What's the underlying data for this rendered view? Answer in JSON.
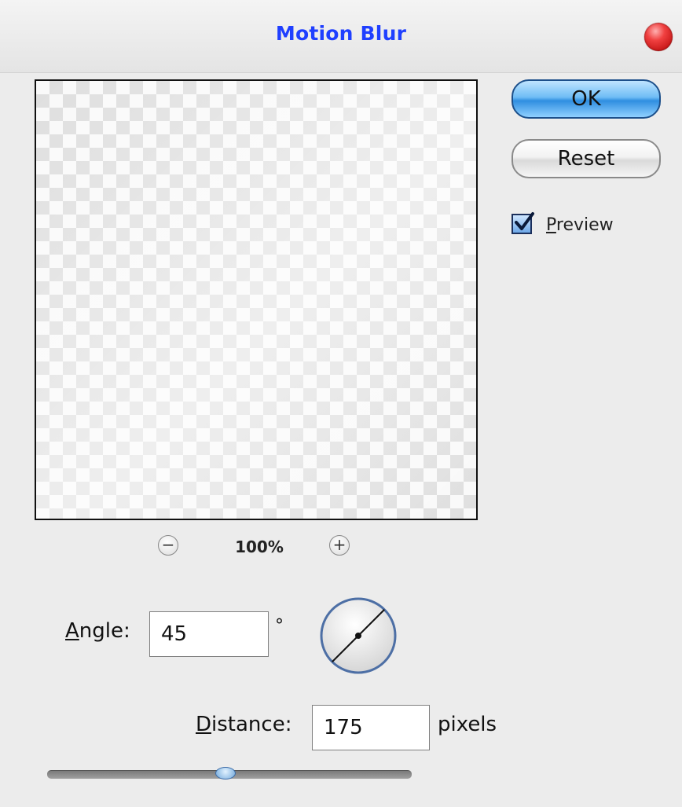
{
  "dialog": {
    "title": "Motion Blur"
  },
  "buttons": {
    "ok_label": "OK",
    "reset_label": "Reset"
  },
  "preview_option": {
    "label": "Preview",
    "checked": true
  },
  "zoom": {
    "level": "100%",
    "zoom_out_symbol": "−",
    "zoom_in_symbol": "+"
  },
  "angle": {
    "label": "Angle:",
    "value": "45",
    "unit": "°",
    "dial_degrees": 45
  },
  "distance": {
    "label": "Distance:",
    "value": "175",
    "unit": "pixels",
    "slider_fraction": 0.49
  },
  "colors": {
    "title_text": "#1f3fff",
    "ok_button": "#3d96e3",
    "close_button": "#e02a2a"
  },
  "icons": {
    "close": "close-icon",
    "zoom_out": "zoom-out-icon",
    "zoom_in": "zoom-in-icon",
    "checkmark": "checkmark-icon",
    "angle_dial": "angle-dial-icon"
  }
}
